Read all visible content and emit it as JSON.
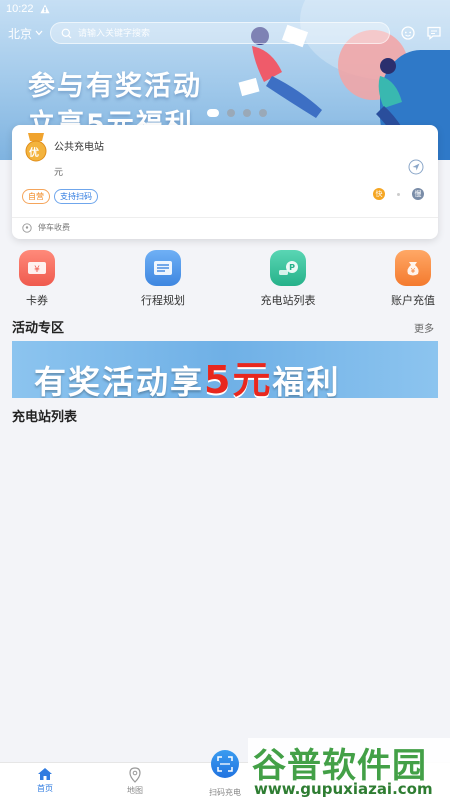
{
  "status_bar": {
    "time": "10:22",
    "warning_icon": "warning-icon"
  },
  "header": {
    "city": "北京",
    "search_placeholder": "请输入关键字搜索",
    "icons": [
      "chevron-down-icon",
      "search-icon",
      "customer-service-icon",
      "message-icon"
    ]
  },
  "banner": {
    "line1": "参与有奖活动",
    "line2": "立享5元福利",
    "page_count": 4,
    "active_page": 0
  },
  "station": {
    "name": "公共充电站",
    "badge": "优",
    "price_unit": "元",
    "tags": [
      "自营",
      "支持扫码"
    ],
    "fast_label": "快",
    "slow_label": "慢",
    "parking": "停车收费"
  },
  "quick_menu": [
    {
      "label": "卡券",
      "icon": "coupon-icon",
      "color": "#f26a5a"
    },
    {
      "label": "行程规划",
      "icon": "route-plan-icon",
      "color": "#4a90e2"
    },
    {
      "label": "充电站列表",
      "icon": "station-list-icon",
      "color": "#34c29a"
    },
    {
      "label": "账户充值",
      "icon": "recharge-icon",
      "color": "#f58a3b"
    }
  ],
  "activity": {
    "title": "活动专区",
    "more": "更多",
    "promo_pre": "有奖活动享",
    "promo_num": "5元",
    "promo_post": "福利"
  },
  "station_list": {
    "title": "充电站列表"
  },
  "bottom_nav": [
    {
      "label": "首页",
      "icon": "home-icon",
      "active": true
    },
    {
      "label": "地图",
      "icon": "map-pin-icon",
      "active": false
    },
    {
      "label": "扫码充电",
      "icon": "scan-icon",
      "active": false
    }
  ],
  "watermark": {
    "main": "谷普软件园",
    "sub": "www.gupuxiazai.com"
  },
  "colors": {
    "accent": "#2f7be0",
    "banner": "#9fc8ea",
    "tag_orange": "#f08a24"
  }
}
